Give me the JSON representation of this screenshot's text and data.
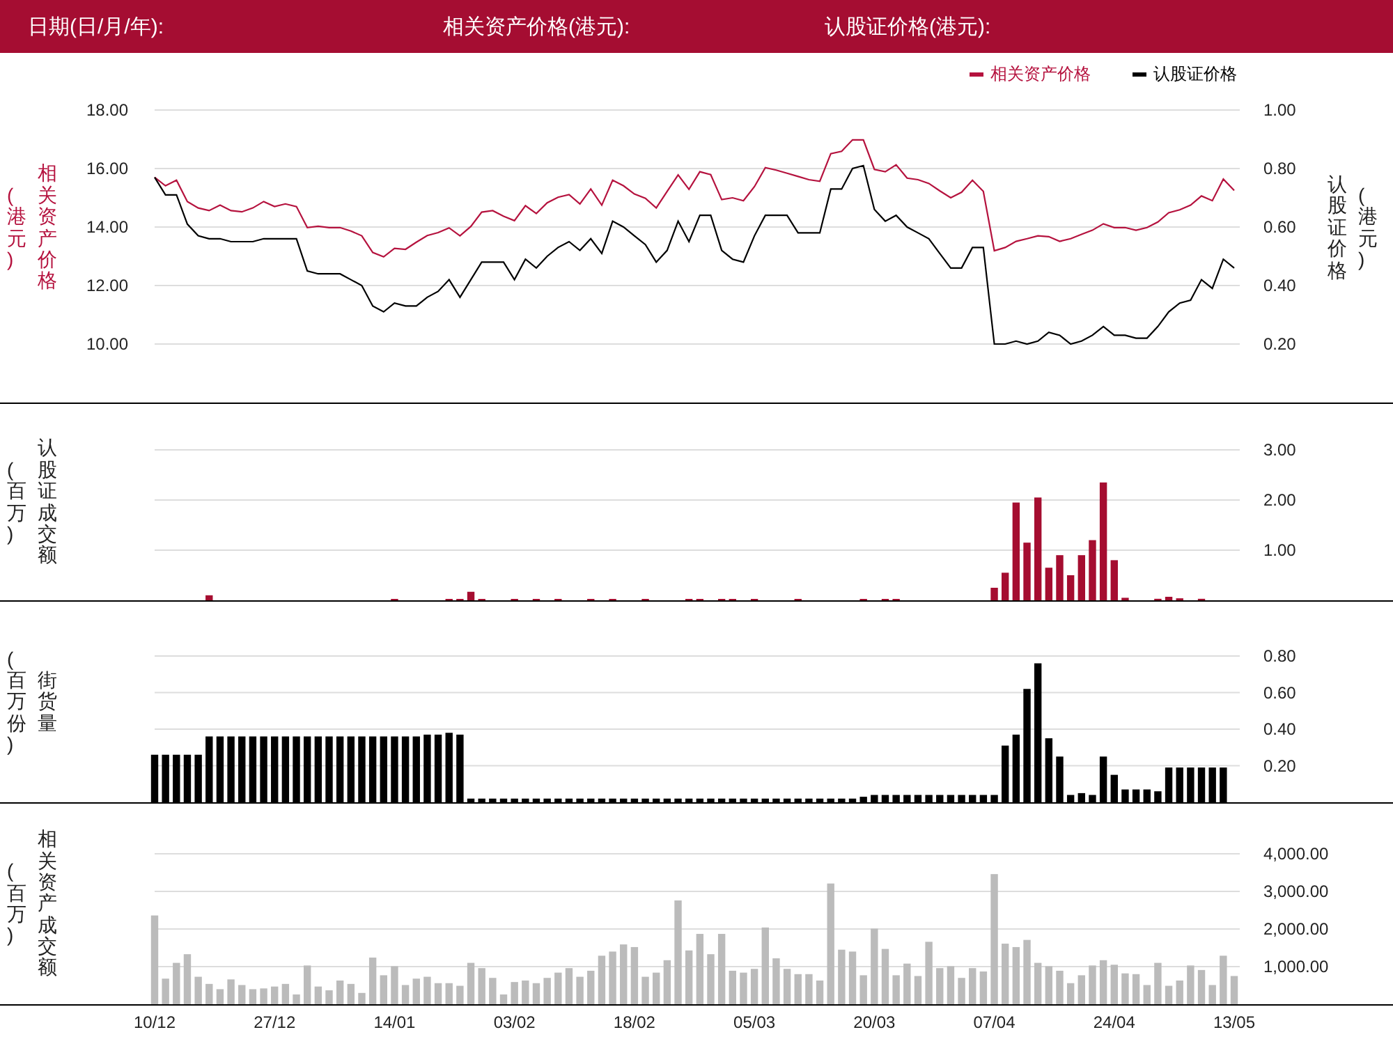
{
  "header": {
    "fields": [
      {
        "label": "日期(日/月/年):"
      },
      {
        "label": "相关资产价格(港元):"
      },
      {
        "label": "认股证价格(港元):"
      }
    ]
  },
  "price_panel": {
    "unit": "(港元)",
    "y2unit": "(港元)",
    "chart_data": {
      "type": "line",
      "grid": true,
      "ylabel": "相关资产价格",
      "y2label": "认股证价格",
      "legend": true,
      "ylim": [
        10,
        18
      ],
      "y2lim": [
        0.2,
        1
      ],
      "yticks": [
        {
          "value": 18,
          "label": "18.00"
        },
        {
          "value": 16,
          "label": "16.00"
        },
        {
          "value": 14,
          "label": "14.00"
        },
        {
          "value": 12,
          "label": "12.00"
        },
        {
          "value": 10,
          "label": "10.00"
        }
      ],
      "y2ticks": [
        {
          "value": 1,
          "label": "1.00"
        },
        {
          "value": 0.8,
          "label": "0.80"
        },
        {
          "value": 0.6,
          "label": "0.60"
        },
        {
          "value": 0.4,
          "label": "0.40"
        },
        {
          "value": 0.2,
          "label": "0.20"
        }
      ],
      "series": [
        {
          "name": "相关资产价格",
          "color": "#b5123e",
          "values": [
            15.7,
            15.41,
            15.6,
            14.87,
            14.65,
            14.56,
            14.75,
            14.56,
            14.52,
            14.65,
            14.87,
            14.7,
            14.79,
            14.7,
            13.98,
            14.03,
            13.98,
            13.98,
            13.86,
            13.7,
            13.13,
            12.98,
            13.27,
            13.24,
            13.48,
            13.71,
            13.81,
            13.97,
            13.7,
            14.02,
            14.51,
            14.56,
            14.37,
            14.22,
            14.73,
            14.46,
            14.83,
            15.02,
            15.11,
            14.79,
            15.3,
            14.75,
            15.6,
            15.41,
            15.13,
            14.98,
            14.65,
            15.22,
            15.78,
            15.29,
            15.89,
            15.79,
            14.94,
            15.0,
            14.9,
            15.38,
            16.03,
            15.95,
            15.84,
            15.73,
            15.62,
            15.56,
            16.51,
            16.59,
            16.98,
            16.98,
            15.97,
            15.89,
            16.13,
            15.67,
            15.62,
            15.49,
            15.24,
            15.0,
            15.19,
            15.6,
            15.22,
            13.19,
            13.3,
            13.51,
            13.6,
            13.7,
            13.67,
            13.51,
            13.6,
            13.75,
            13.89,
            14.11,
            13.98,
            13.98,
            13.89,
            13.98,
            14.17,
            14.49,
            14.59,
            14.75,
            15.06,
            14.9,
            15.64,
            15.25
          ]
        },
        {
          "name": "认股证价格",
          "color": "#000000",
          "axis": "y2",
          "values": [
            0.77,
            0.71,
            0.71,
            0.61,
            0.57,
            0.56,
            0.56,
            0.55,
            0.55,
            0.55,
            0.56,
            0.56,
            0.56,
            0.56,
            0.45,
            0.44,
            0.44,
            0.44,
            0.42,
            0.4,
            0.33,
            0.31,
            0.34,
            0.33,
            0.33,
            0.36,
            0.38,
            0.42,
            0.36,
            0.42,
            0.48,
            0.48,
            0.48,
            0.42,
            0.49,
            0.46,
            0.5,
            0.53,
            0.55,
            0.52,
            0.56,
            0.51,
            0.62,
            0.6,
            0.57,
            0.54,
            0.48,
            0.52,
            0.62,
            0.55,
            0.64,
            0.64,
            0.52,
            0.49,
            0.48,
            0.57,
            0.64,
            0.64,
            0.64,
            0.58,
            0.58,
            0.58,
            0.73,
            0.73,
            0.8,
            0.81,
            0.66,
            0.62,
            0.64,
            0.6,
            0.58,
            0.56,
            0.51,
            0.46,
            0.46,
            0.53,
            0.53,
            0.2,
            0.2,
            0.21,
            0.2,
            0.21,
            0.24,
            0.23,
            0.2,
            0.21,
            0.23,
            0.26,
            0.23,
            0.23,
            0.22,
            0.22,
            0.26,
            0.31,
            0.34,
            0.35,
            0.42,
            0.39,
            0.49,
            0.46
          ]
        }
      ]
    }
  },
  "turnover_panel": {
    "unit": "(百万)",
    "chart_data": {
      "type": "bar",
      "grid": true,
      "ylabel": "认股证成交额",
      "ylim": [
        0,
        3
      ],
      "yticks": [
        {
          "value": 3,
          "label": "3.00"
        },
        {
          "value": 2,
          "label": "2.00"
        },
        {
          "value": 1,
          "label": "1.00"
        }
      ],
      "series": [
        {
          "color": "#a50d30",
          "values": [
            null,
            null,
            null,
            null,
            null,
            0.1,
            null,
            null,
            null,
            null,
            null,
            null,
            null,
            null,
            null,
            null,
            null,
            null,
            null,
            null,
            null,
            null,
            0.02,
            null,
            null,
            null,
            null,
            0.02,
            0.02,
            0.17,
            0.02,
            null,
            null,
            0.02,
            null,
            0.02,
            null,
            0.02,
            null,
            null,
            0.02,
            null,
            0.02,
            null,
            null,
            0.02,
            null,
            null,
            null,
            0.02,
            0.02,
            null,
            0.02,
            0.02,
            null,
            0.02,
            null,
            null,
            null,
            0.02,
            null,
            null,
            null,
            null,
            null,
            0.02,
            null,
            0.02,
            0.02,
            null,
            null,
            null,
            null,
            null,
            null,
            null,
            null,
            0.25,
            0.55,
            1.95,
            1.15,
            2.05,
            0.65,
            0.9,
            0.5,
            0.9,
            1.2,
            2.35,
            0.8,
            0.05,
            null,
            null,
            0.03,
            0.07,
            0.04,
            null,
            0.03,
            null,
            null,
            null
          ]
        }
      ]
    }
  },
  "outstanding_panel": {
    "unit": "(百万份)",
    "chart_data": {
      "type": "bar",
      "grid": true,
      "ylabel": "街货量",
      "ylim": [
        0,
        0.8
      ],
      "yticks": [
        {
          "value": 0.8,
          "label": "0.80"
        },
        {
          "value": 0.6,
          "label": "0.60"
        },
        {
          "value": 0.4,
          "label": "0.40"
        },
        {
          "value": 0.2,
          "label": "0.20"
        }
      ],
      "series": [
        {
          "color": "#000000",
          "values": [
            0.26,
            0.26,
            0.26,
            0.26,
            0.26,
            0.36,
            0.36,
            0.36,
            0.36,
            0.36,
            0.36,
            0.36,
            0.36,
            0.36,
            0.36,
            0.36,
            0.36,
            0.36,
            0.36,
            0.36,
            0.36,
            0.36,
            0.36,
            0.36,
            0.36,
            0.37,
            0.37,
            0.38,
            0.37,
            0.02,
            0.02,
            0.02,
            0.02,
            0.02,
            0.02,
            0.02,
            0.02,
            0.02,
            0.02,
            0.02,
            0.02,
            0.02,
            0.02,
            0.02,
            0.02,
            0.02,
            0.02,
            0.02,
            0.02,
            0.02,
            0.02,
            0.02,
            0.02,
            0.02,
            0.02,
            0.02,
            0.02,
            0.02,
            0.02,
            0.02,
            0.02,
            0.02,
            0.02,
            0.02,
            0.02,
            0.03,
            0.04,
            0.04,
            0.04,
            0.04,
            0.04,
            0.04,
            0.04,
            0.04,
            0.04,
            0.04,
            0.04,
            0.04,
            0.31,
            0.37,
            0.62,
            0.76,
            0.35,
            0.25,
            0.04,
            0.05,
            0.04,
            0.25,
            0.15,
            0.07,
            0.07,
            0.07,
            0.06,
            0.19,
            0.19,
            0.19,
            0.19,
            0.19,
            0.19,
            null
          ]
        }
      ]
    }
  },
  "underlying_turnover_panel": {
    "unit": "(百万)",
    "chart_data": {
      "type": "bar",
      "grid": true,
      "ylabel": "相关资产成交额",
      "ylim": [
        0,
        4000
      ],
      "yticks": [
        {
          "value": 4000,
          "label": "4,000.00"
        },
        {
          "value": 3000,
          "label": "3,000.00"
        },
        {
          "value": 2000,
          "label": "2,000.00"
        },
        {
          "value": 1000,
          "label": "1,000.00"
        }
      ],
      "categories": [
        "10/12",
        null,
        null,
        null,
        null,
        null,
        null,
        null,
        null,
        null,
        null,
        "27/12",
        null,
        null,
        null,
        null,
        null,
        null,
        null,
        null,
        null,
        null,
        "14/01",
        null,
        null,
        null,
        null,
        null,
        null,
        null,
        null,
        null,
        null,
        "03/02",
        null,
        null,
        null,
        null,
        null,
        null,
        null,
        null,
        null,
        null,
        "18/02",
        null,
        null,
        null,
        null,
        null,
        null,
        null,
        null,
        null,
        null,
        "05/03",
        null,
        null,
        null,
        null,
        null,
        null,
        null,
        null,
        null,
        null,
        "20/03",
        null,
        null,
        null,
        null,
        null,
        null,
        null,
        null,
        null,
        null,
        "07/04",
        null,
        null,
        null,
        null,
        null,
        null,
        null,
        null,
        null,
        null,
        "24/04",
        null,
        null,
        null,
        null,
        null,
        null,
        null,
        null,
        null,
        null,
        "13/05"
      ],
      "series": [
        {
          "color": "#bbbbbb",
          "values": [
            2360,
            680,
            1100,
            1330,
            730,
            540,
            400,
            660,
            510,
            400,
            420,
            470,
            540,
            260,
            1030,
            470,
            370,
            630,
            540,
            300,
            1240,
            770,
            1010,
            510,
            680,
            730,
            560,
            560,
            490,
            1100,
            960,
            700,
            260,
            590,
            630,
            560,
            700,
            840,
            960,
            730,
            890,
            1290,
            1400,
            1590,
            1520,
            730,
            840,
            1170,
            2760,
            1430,
            1870,
            1330,
            1870,
            890,
            840,
            940,
            2040,
            1220,
            940,
            800,
            800,
            630,
            3210,
            1450,
            1400,
            770,
            2010,
            1470,
            770,
            1080,
            750,
            1660,
            960,
            1010,
            700,
            960,
            870,
            3460,
            1610,
            1520,
            1710,
            1100,
            1010,
            890,
            560,
            770,
            1030,
            1170,
            1050,
            820,
            800,
            510,
            1100,
            490,
            630,
            1030,
            910,
            510,
            1290,
            750
          ]
        }
      ]
    }
  }
}
